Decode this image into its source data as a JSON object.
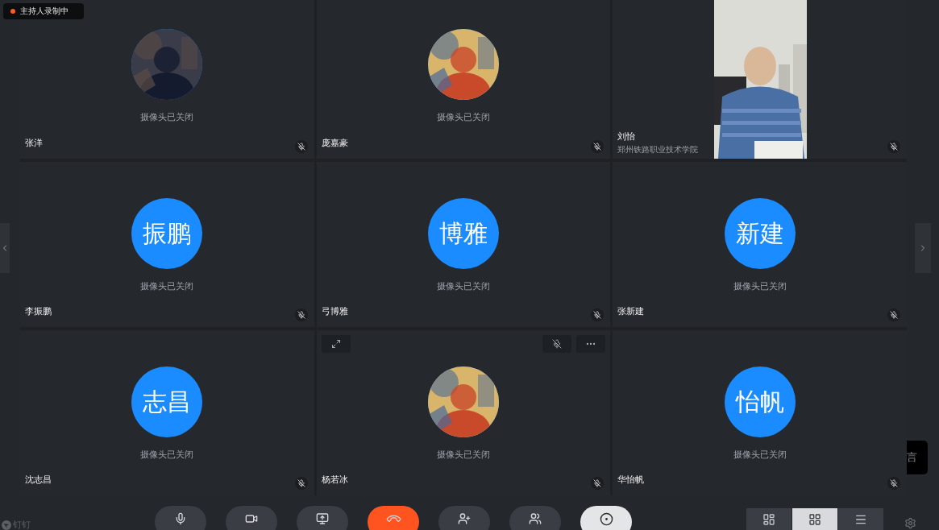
{
  "recording_badge": {
    "text": "主持人录制中",
    "recording": true
  },
  "tiles": [
    {
      "name": "张洋",
      "camera_status": "摄像头已关闭",
      "muted": true,
      "show_controls": false
    },
    {
      "name": "庞嘉豪",
      "camera_status": "摄像头已关闭",
      "muted": true,
      "show_controls": false
    },
    {
      "name": "刘怡",
      "subtitle": "郑州铁路职业技术学院",
      "avatar": {
        "kind": "video"
      },
      "muted": true,
      "show_controls": false
    },
    {
      "name": "李振鹏",
      "avatar": {
        "kind": "initials",
        "text": "振鹏"
      },
      "camera_status": "摄像头已关闭",
      "muted": true,
      "show_controls": false
    },
    {
      "name": "弓博雅",
      "avatar": {
        "kind": "initials",
        "text": "博雅"
      },
      "camera_status": "摄像头已关闭",
      "muted": true,
      "show_controls": false
    },
    {
      "name": "张新建",
      "avatar": {
        "kind": "initials",
        "text": "新建"
      },
      "camera_status": "摄像头已关闭",
      "muted": true,
      "show_controls": false
    },
    {
      "name": "沈志昌",
      "avatar": {
        "kind": "initials",
        "text": "志昌"
      },
      "camera_status": "摄像头已关闭",
      "muted": true,
      "show_controls": false
    },
    {
      "name": "杨若冰",
      "camera_status": "摄像头已关闭",
      "muted": true,
      "show_controls": true
    },
    {
      "name": "华怡帆",
      "avatar": {
        "kind": "initials",
        "text": "怡帆"
      },
      "camera_status": "摄像头已关闭",
      "muted": true,
      "show_controls": false
    }
  ],
  "side_tab": {
    "text": "言"
  },
  "app_label": {
    "text": "钉钉"
  },
  "toolbar": [
    {
      "kind": "mic",
      "active": false
    },
    {
      "kind": "camera",
      "active": false
    },
    {
      "kind": "share",
      "active": false
    },
    {
      "kind": "hangup",
      "active": false
    },
    {
      "kind": "invite",
      "active": false
    },
    {
      "kind": "members",
      "active": false
    },
    {
      "kind": "record",
      "active": true
    }
  ],
  "view_modes": [
    {
      "kind": "speaker",
      "selected": false
    },
    {
      "kind": "grid",
      "selected": true
    },
    {
      "kind": "list",
      "selected": false
    }
  ]
}
